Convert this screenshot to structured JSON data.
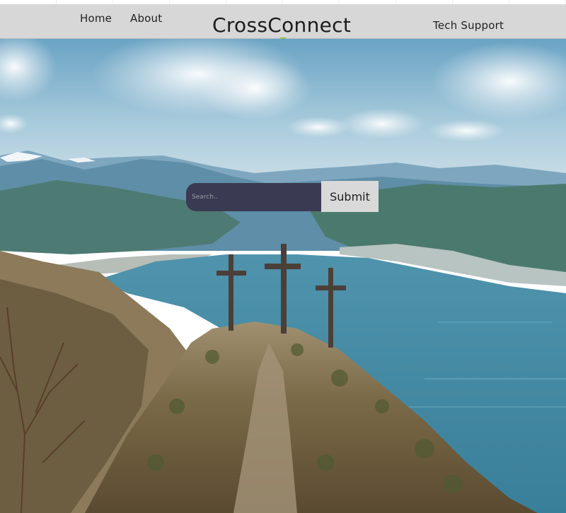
{
  "navbar": {
    "home_label": "Home",
    "about_label": "About",
    "brand": "CrossConnect",
    "support_label": "Tech Support"
  },
  "search": {
    "placeholder": "Search..",
    "value": "",
    "submit_label": "Submit"
  },
  "colors": {
    "navbar_bg": "#d7d7d7",
    "search_bg": "#3a3b52",
    "submit_bg": "#d9d9d9",
    "brand_caret": "#8bc34a"
  },
  "hero": {
    "icon": "mountain-crosses-landscape"
  }
}
